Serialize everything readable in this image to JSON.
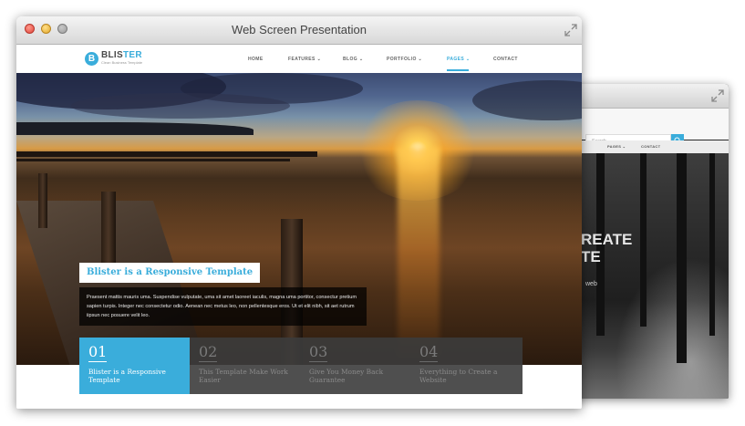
{
  "window": {
    "title": "Web Screen Presentation"
  },
  "site": {
    "logo": {
      "letter": "B",
      "name_part1": "BLIS",
      "name_part2": "TER",
      "tagline": "Clean Business Template"
    },
    "nav": [
      {
        "label": "HOME"
      },
      {
        "label": "FEATURES ⌄"
      },
      {
        "label": "BLOG ⌄"
      },
      {
        "label": "PORTFOLIO ⌄"
      },
      {
        "label": "PAGES ⌄",
        "active": true
      },
      {
        "label": "CONTACT"
      }
    ]
  },
  "hero": {
    "caption_title": "Blister is a Responsive Template",
    "caption_body": "Praesent mattis mauris uma. Suspendise vulputate, uma sit amet laoreet iaculis, magna uma portitor, consectur pretium sapien turpis. Integer nec consectetur odio. Aenean nec metus leo, non pellentesque eros. Ut et elit nibh, sit aet rutrum iipsun nec posuere velit leo."
  },
  "tabs": [
    {
      "number": "01",
      "text": "Blister is a Responsive Template",
      "active": true
    },
    {
      "number": "02",
      "text": "This Template Make Work Easier",
      "active": false
    },
    {
      "number": "03",
      "text": "Give You Money Back Guarantee",
      "active": false
    },
    {
      "number": "04",
      "text": "Everything to Create a Website",
      "active": false
    }
  ],
  "back_window": {
    "search_placeholder": "Search",
    "nav_pages": "PAGES ⌄",
    "nav_contact": "CONTACT",
    "hero_line1": "REATE",
    "hero_line2": "TE",
    "hero_sub": "web"
  },
  "colors": {
    "accent": "#3aaddb",
    "tab_dark": "#3c3c3c"
  }
}
